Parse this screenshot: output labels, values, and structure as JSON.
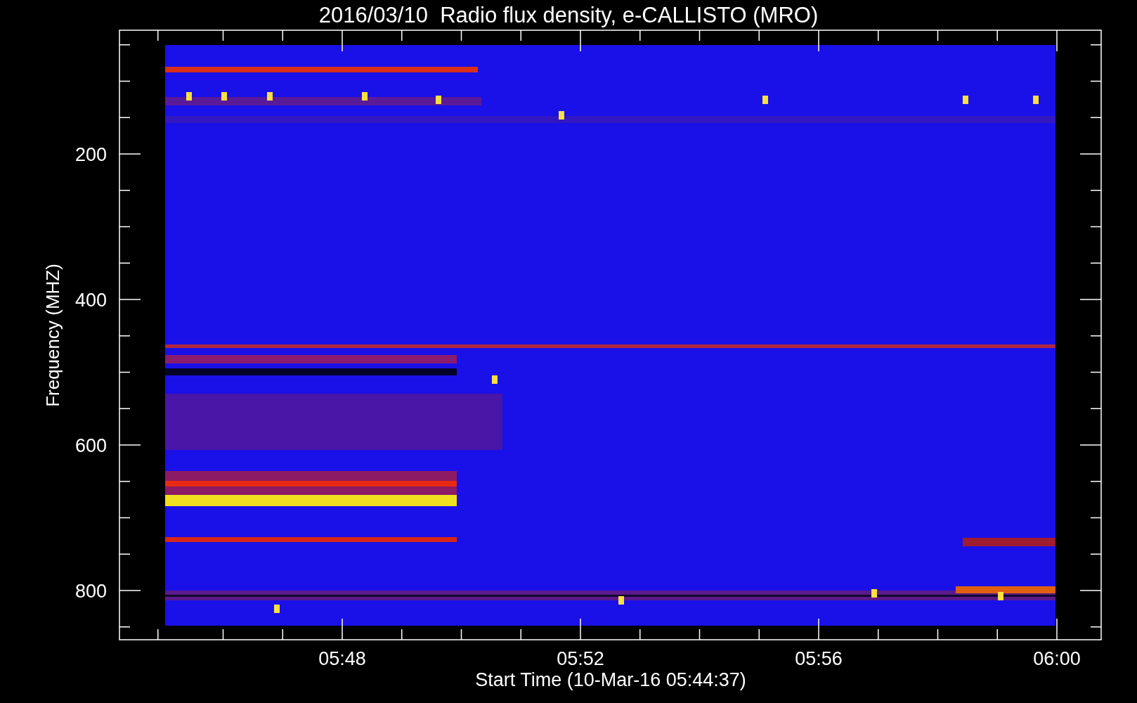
{
  "title": "2016/03/10  Radio flux density, e-CALLISTO (MRO)",
  "ylabel": "Frequency (MHZ)",
  "xlabel": "Start Time (10-Mar-16 05:44:37)",
  "yticks": [
    "200",
    "400",
    "600",
    "800"
  ],
  "xticks": [
    "05:48",
    "05:52",
    "05:56",
    "06:00"
  ]
}
